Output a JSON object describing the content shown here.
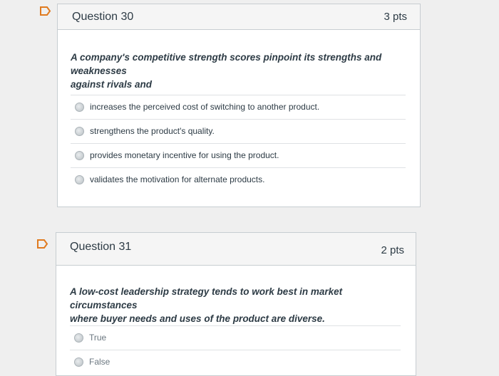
{
  "questions": [
    {
      "title": "Question 30",
      "points": "3 pts",
      "text_line1": "A company's competitive strength scores pinpoint its strengths and weaknesses",
      "text_line2": "against rivals and",
      "answers": [
        "increases the perceived cost of switching to another product.",
        "strengthens the product's quality.",
        "provides monetary incentive for using the product.",
        "validates the motivation for alternate products."
      ]
    },
    {
      "title": "Question 31",
      "points": "2 pts",
      "text_line1": "A low-cost leadership strategy tends to work best in market circumstances",
      "text_line2": "where buyer needs and uses of the product are diverse.",
      "answers": [
        "True",
        "False"
      ]
    }
  ],
  "colors": {
    "flag_outline": "#e07a1f",
    "card_border": "#c7cdd1",
    "header_bg": "#f5f5f5",
    "page_bg": "#efefef"
  },
  "icons": [
    "flag-question-icon"
  ]
}
